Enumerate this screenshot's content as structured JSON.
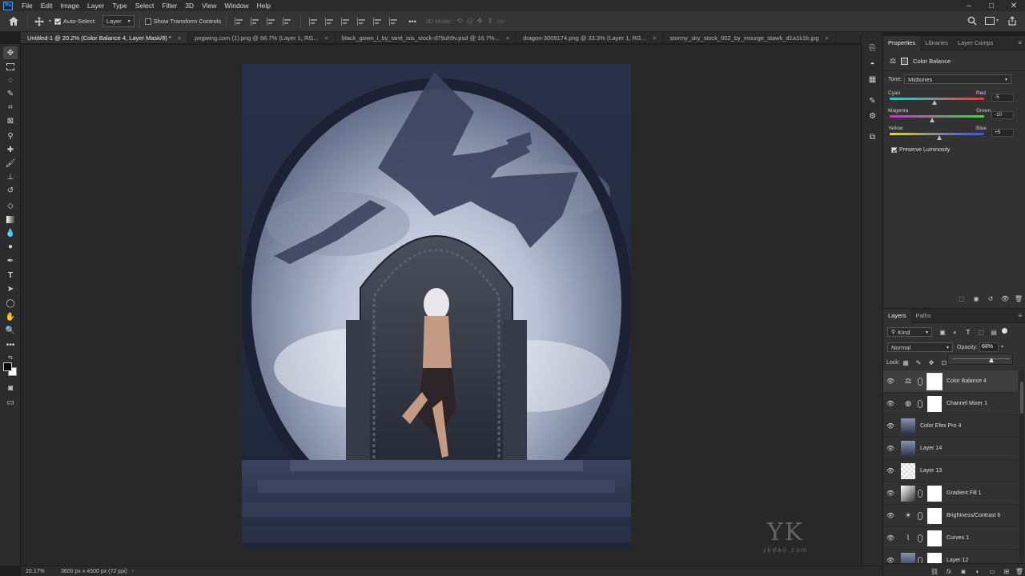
{
  "app": {
    "logo": "Ps"
  },
  "menu": [
    "File",
    "Edit",
    "Image",
    "Layer",
    "Type",
    "Select",
    "Filter",
    "3D",
    "View",
    "Window",
    "Help"
  ],
  "window_controls": {
    "minimize": "–",
    "maximize": "□",
    "close": "✕"
  },
  "options_bar": {
    "auto_select_label": "Auto-Select:",
    "auto_select_target": "Layer",
    "show_transform_label": "Show Transform Controls",
    "mode_3d_label": "3D Mode:",
    "more_label": "•••"
  },
  "tabs": [
    {
      "label": "Untitled-1 @ 20.2% (Color Balance 4, Layer Mask/8) *",
      "active": true
    },
    {
      "label": "pngwing.com (1).png @ 66.7% (Layer 1, RG...",
      "active": false
    },
    {
      "label": "black_gown_i_by_tanit_isis_stock-d79uh9v.psd @ 16.7%...",
      "active": false
    },
    {
      "label": "dragon-3009174.png @ 33.3% (Layer 1, RG...",
      "active": false
    },
    {
      "label": "stormy_sky_stock_002_by_inourge_stawk_d1a1k1b.jpg",
      "active": false
    }
  ],
  "status": {
    "zoom": "20.17%",
    "doc_info": "3600 px x 4500 px (72 ppi)"
  },
  "watermark": {
    "brand": "YK",
    "site": "ykdao.com"
  },
  "properties": {
    "tabs": [
      "Properties",
      "Libraries",
      "Layer Comps"
    ],
    "title": "Color Balance",
    "tone_label": "Tone:",
    "tone_value": "Midtones",
    "sliders": [
      {
        "left": "Cyan",
        "right": "Red",
        "value": "-5",
        "num": -5
      },
      {
        "left": "Magenta",
        "right": "Green",
        "value": "-10",
        "num": -10
      },
      {
        "left": "Yellow",
        "right": "Blue",
        "value": "+5",
        "num": 5
      }
    ],
    "preserve_luminosity": "Preserve Luminosity"
  },
  "layers_panel": {
    "tabs": [
      "Layers",
      "Paths"
    ],
    "filter_kind": "Kind",
    "blend_mode": "Normal",
    "opacity_label": "Opacity:",
    "opacity_value": "68%",
    "lock_label": "Lock:",
    "layers": [
      {
        "name": "Color Balance 4",
        "kind": "adjustment",
        "icon": "balance-icon",
        "mask": true,
        "selected": true
      },
      {
        "name": "Channel Mixer 1",
        "kind": "adjustment",
        "icon": "channel-mixer-icon",
        "mask": true,
        "selected": false
      },
      {
        "name": "Color Efex Pro 4",
        "kind": "image",
        "icon": "",
        "mask": false,
        "selected": false
      },
      {
        "name": "Layer 14",
        "kind": "image",
        "icon": "",
        "mask": false,
        "selected": false
      },
      {
        "name": "Layer 13",
        "kind": "transparent",
        "icon": "",
        "mask": false,
        "selected": false
      },
      {
        "name": "Gradient Fill 1",
        "kind": "gradient",
        "icon": "",
        "mask": true,
        "selected": false
      },
      {
        "name": "Brightness/Contrast 6",
        "kind": "adjustment",
        "icon": "brightness-icon",
        "mask": true,
        "selected": false
      },
      {
        "name": "Curves 1",
        "kind": "adjustment",
        "icon": "curves-icon",
        "mask": true,
        "selected": false
      },
      {
        "name": "Layer 12",
        "kind": "image",
        "icon": "",
        "mask": true,
        "selected": false
      }
    ]
  },
  "colors": {
    "accent": "#31a8ff",
    "panel_bg": "#323232",
    "canvas_bg": "#282828"
  }
}
